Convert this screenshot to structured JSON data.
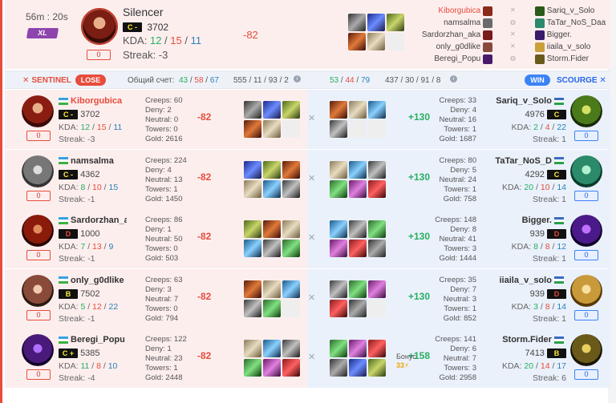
{
  "header": {
    "duration": "56m : 20s",
    "badge": "XL",
    "hero_name": "Silencer",
    "rank_badge": "C -",
    "rating": "3702",
    "kda_label": "KDA:",
    "kda": {
      "k": "12",
      "d": "15",
      "a": "11"
    },
    "streak": "Streak: -3",
    "qual": "0",
    "delta": "-82",
    "left_names": [
      "Kiborgubica",
      "namsalma",
      "Sardorzhan_aka",
      "only_g0dlike",
      "Beregi_Popu"
    ],
    "right_names": [
      "Sariq_v_Solo",
      "TaTar_NoS_Daa",
      "Bigger.",
      "iiaila_v_solo",
      "Storm.Fider"
    ]
  },
  "scorebar": {
    "sentinel": "SENTINEL",
    "lose": "LOSE",
    "total_label": "Общий счет:",
    "left_score": {
      "a": "43",
      "b": "58",
      "c": "67"
    },
    "left_creeps": "555 / 11 / 93 / 2",
    "right_score": {
      "a": "53",
      "b": "44",
      "c": "79"
    },
    "right_creeps": "437 / 30 / 91 / 8",
    "win": "WIN",
    "scourge": "SCOURGE"
  },
  "labels": {
    "creeps": "Creeps:",
    "deny": "Deny:",
    "neutral": "Neutral:",
    "towers": "Towers:",
    "gold": "Gold:",
    "kda": "KDA:",
    "streak": "Streak:"
  },
  "rows": [
    {
      "left": {
        "name": "Kiborgubica",
        "rank": "C -",
        "rating": "3702",
        "k": "12",
        "d": "15",
        "a": "11",
        "streak": "-3",
        "qual": "0",
        "creeps": "60",
        "deny": "2",
        "neutral": "0",
        "towers": "0",
        "gold": "2616",
        "delta": "-82"
      },
      "right": {
        "name": "Sariq_v_Solo",
        "rank": "C",
        "rating": "4976",
        "k": "2",
        "d": "4",
        "a": "22",
        "streak": "1",
        "qual": "0",
        "creeps": "33",
        "deny": "4",
        "neutral": "16",
        "towers": "1",
        "gold": "1687",
        "delta": "+130"
      }
    },
    {
      "left": {
        "name": "namsalma",
        "rank": "C -",
        "rating": "4362",
        "k": "8",
        "d": "10",
        "a": "15",
        "streak": "-1",
        "qual": "0",
        "creeps": "224",
        "deny": "4",
        "neutral": "13",
        "towers": "1",
        "gold": "1450",
        "delta": "-82"
      },
      "right": {
        "name": "TaTar_NoS_D",
        "rank": "C",
        "rating": "4292",
        "k": "20",
        "d": "10",
        "a": "14",
        "streak": "1",
        "qual": "0",
        "creeps": "80",
        "deny": "5",
        "neutral": "24",
        "towers": "1",
        "gold": "758",
        "delta": "+130"
      }
    },
    {
      "left": {
        "name": "Sardorzhan_a",
        "rank": "D",
        "rating": "1000",
        "k": "7",
        "d": "13",
        "a": "9",
        "streak": "-1",
        "qual": "0",
        "creeps": "86",
        "deny": "1",
        "neutral": "50",
        "towers": "0",
        "gold": "503",
        "delta": "-82"
      },
      "right": {
        "name": "Bigger.",
        "rank": "D",
        "rating": "939",
        "k": "8",
        "d": "8",
        "a": "12",
        "streak": "1",
        "qual": "0",
        "creeps": "148",
        "deny": "8",
        "neutral": "41",
        "towers": "3",
        "gold": "1444",
        "delta": "+130"
      }
    },
    {
      "left": {
        "name": "only_g0dlike",
        "rank": "B",
        "rating": "7502",
        "k": "5",
        "d": "12",
        "a": "22",
        "streak": "-1",
        "qual": "0",
        "creeps": "63",
        "deny": "3",
        "neutral": "7",
        "towers": "0",
        "gold": "794",
        "delta": "-82"
      },
      "right": {
        "name": "iiaila_v_solo",
        "rank": "D",
        "rating": "939",
        "k": "3",
        "d": "8",
        "a": "14",
        "streak": "1",
        "qual": "0",
        "creeps": "35",
        "deny": "7",
        "neutral": "3",
        "towers": "1",
        "gold": "852",
        "delta": "+130"
      }
    },
    {
      "left": {
        "name": "Beregi_Popu",
        "rank": "C +",
        "rating": "5385",
        "k": "11",
        "d": "8",
        "a": "10",
        "streak": "-4",
        "qual": "0",
        "creeps": "122",
        "deny": "1",
        "neutral": "23",
        "towers": "1",
        "gold": "2448",
        "delta": "-82"
      },
      "right": {
        "name": "Storm.Fider",
        "rank": "B",
        "rating": "7413",
        "k": "20",
        "d": "14",
        "a": "17",
        "streak": "6",
        "qual": "0",
        "creeps": "141",
        "deny": "6",
        "neutral": "7",
        "towers": "3",
        "gold": "2958",
        "delta": "+158"
      }
    }
  ],
  "bonus": {
    "label": "Бонус",
    "value": "33"
  },
  "colors": {
    "lose": "#e74c3c",
    "win": "#3b82f6",
    "gain": "#27ae60",
    "loss": "#e74c3c"
  }
}
